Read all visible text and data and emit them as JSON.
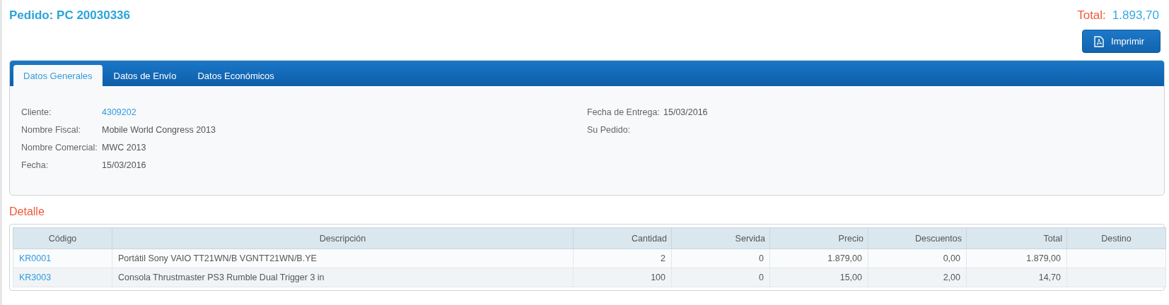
{
  "order": {
    "title": "Pedido: PC 20030336",
    "total_label": "Total:",
    "total_value": "1.893,70",
    "print_button": "Imprimir"
  },
  "tabs": [
    {
      "label": "Datos Generales",
      "selected": true
    },
    {
      "label": "Datos de Envío",
      "selected": false
    },
    {
      "label": "Datos Económicos",
      "selected": false
    }
  ],
  "general": {
    "left": [
      {
        "label": "Cliente:",
        "value": "4309202",
        "kind": "link"
      },
      {
        "label": "Nombre Fiscal:",
        "value": "Mobile World Congress 2013",
        "kind": "text"
      },
      {
        "label": "Nombre Comercial:",
        "value": "MWC 2013",
        "kind": "text"
      },
      {
        "label": "Fecha:",
        "value": "15/03/2016",
        "kind": "text"
      }
    ],
    "right": [
      {
        "label": "Fecha de Entrega:",
        "value": "15/03/2016"
      },
      {
        "label": "Su Pedido:"
      }
    ]
  },
  "detail": {
    "title": "Detalle",
    "columns": [
      "Código",
      "Descripción",
      "Cantidad",
      "Servida",
      "Precio",
      "Descuentos",
      "Total",
      "Destino"
    ],
    "rows": [
      {
        "code": "KR0001",
        "description": "Portátil Sony VAIO TT21WN/B VGNTT21WN/B.YE",
        "quantity": "2",
        "served": "0",
        "price": "1.879,00",
        "discounts": "0,00",
        "total": "1.879,00"
      },
      {
        "code": "KR3003",
        "description": "Consola Thrustmaster PS3 Rumble Dual Trigger 3 in",
        "quantity": "100",
        "served": "0",
        "price": "15,00",
        "discounts": "2,00",
        "total": "14,70"
      }
    ]
  }
}
